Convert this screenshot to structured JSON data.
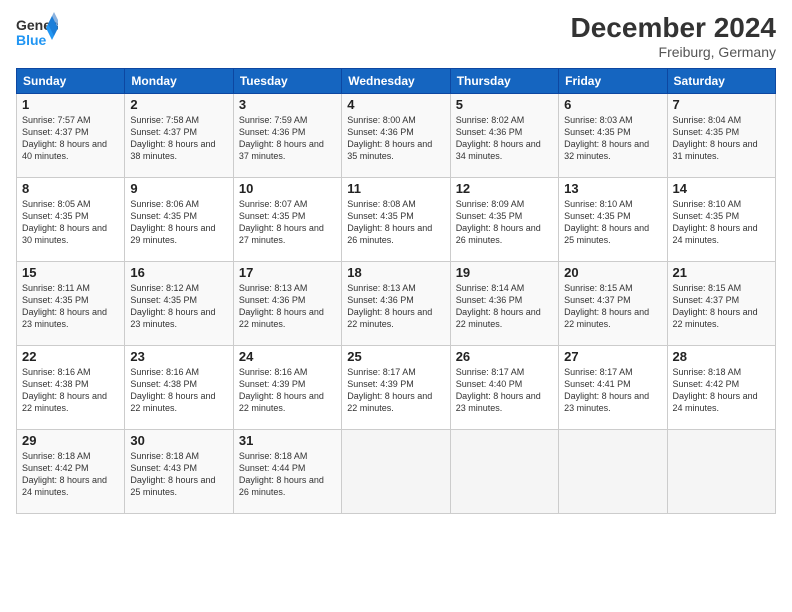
{
  "header": {
    "logo_general": "General",
    "logo_blue": "Blue",
    "month": "December 2024",
    "location": "Freiburg, Germany"
  },
  "days_of_week": [
    "Sunday",
    "Monday",
    "Tuesday",
    "Wednesday",
    "Thursday",
    "Friday",
    "Saturday"
  ],
  "weeks": [
    [
      {
        "day": "1",
        "sunrise": "Sunrise: 7:57 AM",
        "sunset": "Sunset: 4:37 PM",
        "daylight": "Daylight: 8 hours and 40 minutes."
      },
      {
        "day": "2",
        "sunrise": "Sunrise: 7:58 AM",
        "sunset": "Sunset: 4:37 PM",
        "daylight": "Daylight: 8 hours and 38 minutes."
      },
      {
        "day": "3",
        "sunrise": "Sunrise: 7:59 AM",
        "sunset": "Sunset: 4:36 PM",
        "daylight": "Daylight: 8 hours and 37 minutes."
      },
      {
        "day": "4",
        "sunrise": "Sunrise: 8:00 AM",
        "sunset": "Sunset: 4:36 PM",
        "daylight": "Daylight: 8 hours and 35 minutes."
      },
      {
        "day": "5",
        "sunrise": "Sunrise: 8:02 AM",
        "sunset": "Sunset: 4:36 PM",
        "daylight": "Daylight: 8 hours and 34 minutes."
      },
      {
        "day": "6",
        "sunrise": "Sunrise: 8:03 AM",
        "sunset": "Sunset: 4:35 PM",
        "daylight": "Daylight: 8 hours and 32 minutes."
      },
      {
        "day": "7",
        "sunrise": "Sunrise: 8:04 AM",
        "sunset": "Sunset: 4:35 PM",
        "daylight": "Daylight: 8 hours and 31 minutes."
      }
    ],
    [
      {
        "day": "8",
        "sunrise": "Sunrise: 8:05 AM",
        "sunset": "Sunset: 4:35 PM",
        "daylight": "Daylight: 8 hours and 30 minutes."
      },
      {
        "day": "9",
        "sunrise": "Sunrise: 8:06 AM",
        "sunset": "Sunset: 4:35 PM",
        "daylight": "Daylight: 8 hours and 29 minutes."
      },
      {
        "day": "10",
        "sunrise": "Sunrise: 8:07 AM",
        "sunset": "Sunset: 4:35 PM",
        "daylight": "Daylight: 8 hours and 27 minutes."
      },
      {
        "day": "11",
        "sunrise": "Sunrise: 8:08 AM",
        "sunset": "Sunset: 4:35 PM",
        "daylight": "Daylight: 8 hours and 26 minutes."
      },
      {
        "day": "12",
        "sunrise": "Sunrise: 8:09 AM",
        "sunset": "Sunset: 4:35 PM",
        "daylight": "Daylight: 8 hours and 26 minutes."
      },
      {
        "day": "13",
        "sunrise": "Sunrise: 8:10 AM",
        "sunset": "Sunset: 4:35 PM",
        "daylight": "Daylight: 8 hours and 25 minutes."
      },
      {
        "day": "14",
        "sunrise": "Sunrise: 8:10 AM",
        "sunset": "Sunset: 4:35 PM",
        "daylight": "Daylight: 8 hours and 24 minutes."
      }
    ],
    [
      {
        "day": "15",
        "sunrise": "Sunrise: 8:11 AM",
        "sunset": "Sunset: 4:35 PM",
        "daylight": "Daylight: 8 hours and 23 minutes."
      },
      {
        "day": "16",
        "sunrise": "Sunrise: 8:12 AM",
        "sunset": "Sunset: 4:35 PM",
        "daylight": "Daylight: 8 hours and 23 minutes."
      },
      {
        "day": "17",
        "sunrise": "Sunrise: 8:13 AM",
        "sunset": "Sunset: 4:36 PM",
        "daylight": "Daylight: 8 hours and 22 minutes."
      },
      {
        "day": "18",
        "sunrise": "Sunrise: 8:13 AM",
        "sunset": "Sunset: 4:36 PM",
        "daylight": "Daylight: 8 hours and 22 minutes."
      },
      {
        "day": "19",
        "sunrise": "Sunrise: 8:14 AM",
        "sunset": "Sunset: 4:36 PM",
        "daylight": "Daylight: 8 hours and 22 minutes."
      },
      {
        "day": "20",
        "sunrise": "Sunrise: 8:15 AM",
        "sunset": "Sunset: 4:37 PM",
        "daylight": "Daylight: 8 hours and 22 minutes."
      },
      {
        "day": "21",
        "sunrise": "Sunrise: 8:15 AM",
        "sunset": "Sunset: 4:37 PM",
        "daylight": "Daylight: 8 hours and 22 minutes."
      }
    ],
    [
      {
        "day": "22",
        "sunrise": "Sunrise: 8:16 AM",
        "sunset": "Sunset: 4:38 PM",
        "daylight": "Daylight: 8 hours and 22 minutes."
      },
      {
        "day": "23",
        "sunrise": "Sunrise: 8:16 AM",
        "sunset": "Sunset: 4:38 PM",
        "daylight": "Daylight: 8 hours and 22 minutes."
      },
      {
        "day": "24",
        "sunrise": "Sunrise: 8:16 AM",
        "sunset": "Sunset: 4:39 PM",
        "daylight": "Daylight: 8 hours and 22 minutes."
      },
      {
        "day": "25",
        "sunrise": "Sunrise: 8:17 AM",
        "sunset": "Sunset: 4:39 PM",
        "daylight": "Daylight: 8 hours and 22 minutes."
      },
      {
        "day": "26",
        "sunrise": "Sunrise: 8:17 AM",
        "sunset": "Sunset: 4:40 PM",
        "daylight": "Daylight: 8 hours and 23 minutes."
      },
      {
        "day": "27",
        "sunrise": "Sunrise: 8:17 AM",
        "sunset": "Sunset: 4:41 PM",
        "daylight": "Daylight: 8 hours and 23 minutes."
      },
      {
        "day": "28",
        "sunrise": "Sunrise: 8:18 AM",
        "sunset": "Sunset: 4:42 PM",
        "daylight": "Daylight: 8 hours and 24 minutes."
      }
    ],
    [
      {
        "day": "29",
        "sunrise": "Sunrise: 8:18 AM",
        "sunset": "Sunset: 4:42 PM",
        "daylight": "Daylight: 8 hours and 24 minutes."
      },
      {
        "day": "30",
        "sunrise": "Sunrise: 8:18 AM",
        "sunset": "Sunset: 4:43 PM",
        "daylight": "Daylight: 8 hours and 25 minutes."
      },
      {
        "day": "31",
        "sunrise": "Sunrise: 8:18 AM",
        "sunset": "Sunset: 4:44 PM",
        "daylight": "Daylight: 8 hours and 26 minutes."
      },
      null,
      null,
      null,
      null
    ]
  ]
}
